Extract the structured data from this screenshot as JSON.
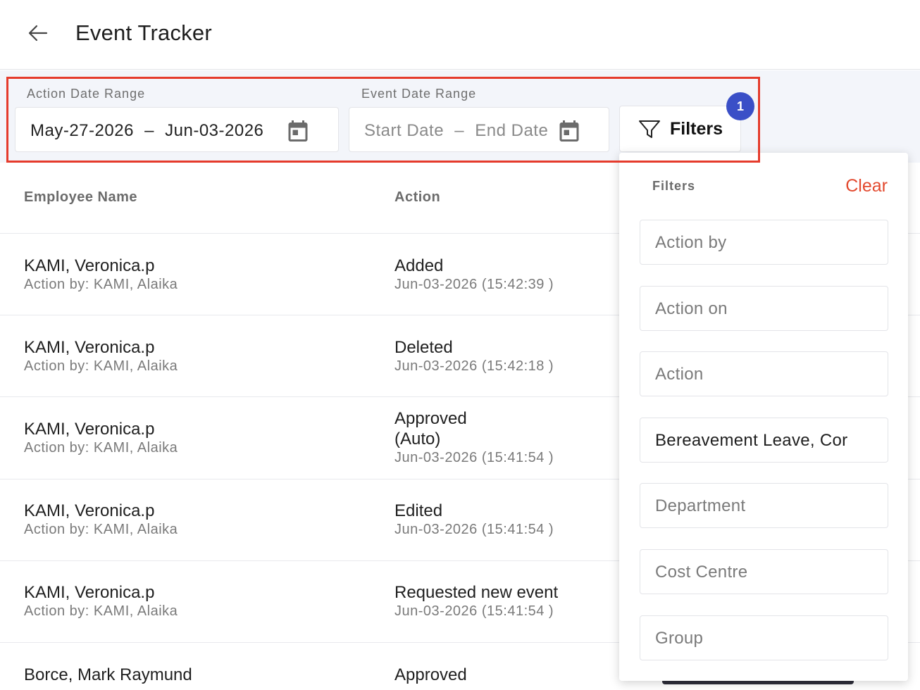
{
  "header": {
    "title": "Event Tracker",
    "back_icon": "arrow-left-icon"
  },
  "filterbar": {
    "action_date": {
      "label": "Action Date Range",
      "start": "May-27-2026",
      "sep": "–",
      "end": "Jun-03-2026"
    },
    "event_date": {
      "label": "Event Date Range",
      "start_placeholder": "Start Date",
      "sep": "–",
      "end_placeholder": "End Date"
    },
    "filters_button": {
      "label": "Filters",
      "badge": "1"
    }
  },
  "table": {
    "columns": [
      "Employee Name",
      "Action"
    ],
    "rows": [
      {
        "name": "KAMI, Veronica.p",
        "by": "Action by: KAMI, Alaika",
        "action": "Added",
        "time": "Jun-03-2026 (15:42:39 )"
      },
      {
        "name": "KAMI, Veronica.p",
        "by": "Action by: KAMI, Alaika",
        "action": "Deleted",
        "time": "Jun-03-2026 (15:42:18 )"
      },
      {
        "name": "KAMI, Veronica.p",
        "by": "Action by: KAMI, Alaika",
        "action": "Approved",
        "action2": "(Auto)",
        "time": "Jun-03-2026 (15:41:54 )"
      },
      {
        "name": "KAMI, Veronica.p",
        "by": "Action by: KAMI, Alaika",
        "action": "Edited",
        "time": "Jun-03-2026 (15:41:54 )"
      },
      {
        "name": "KAMI, Veronica.p",
        "by": "Action by: KAMI, Alaika",
        "action": "Requested new event",
        "time": "Jun-03-2026 (15:41:54 )"
      },
      {
        "name": "Borce, Mark Raymund",
        "action": "Approved"
      }
    ]
  },
  "filter_panel": {
    "title": "Filters",
    "clear_label": "Clear",
    "fields": [
      {
        "placeholder": "Action by"
      },
      {
        "placeholder": "Action on"
      },
      {
        "placeholder": "Action"
      },
      {
        "value": "Bereavement Leave, Cor"
      },
      {
        "placeholder": "Department"
      },
      {
        "placeholder": "Cost Centre"
      },
      {
        "placeholder": "Group"
      }
    ]
  },
  "colors": {
    "highlight": "#e53b2c",
    "badge": "#3a4fc7",
    "clear": "#e34a2f",
    "bar_bg": "#f3f5fa"
  }
}
